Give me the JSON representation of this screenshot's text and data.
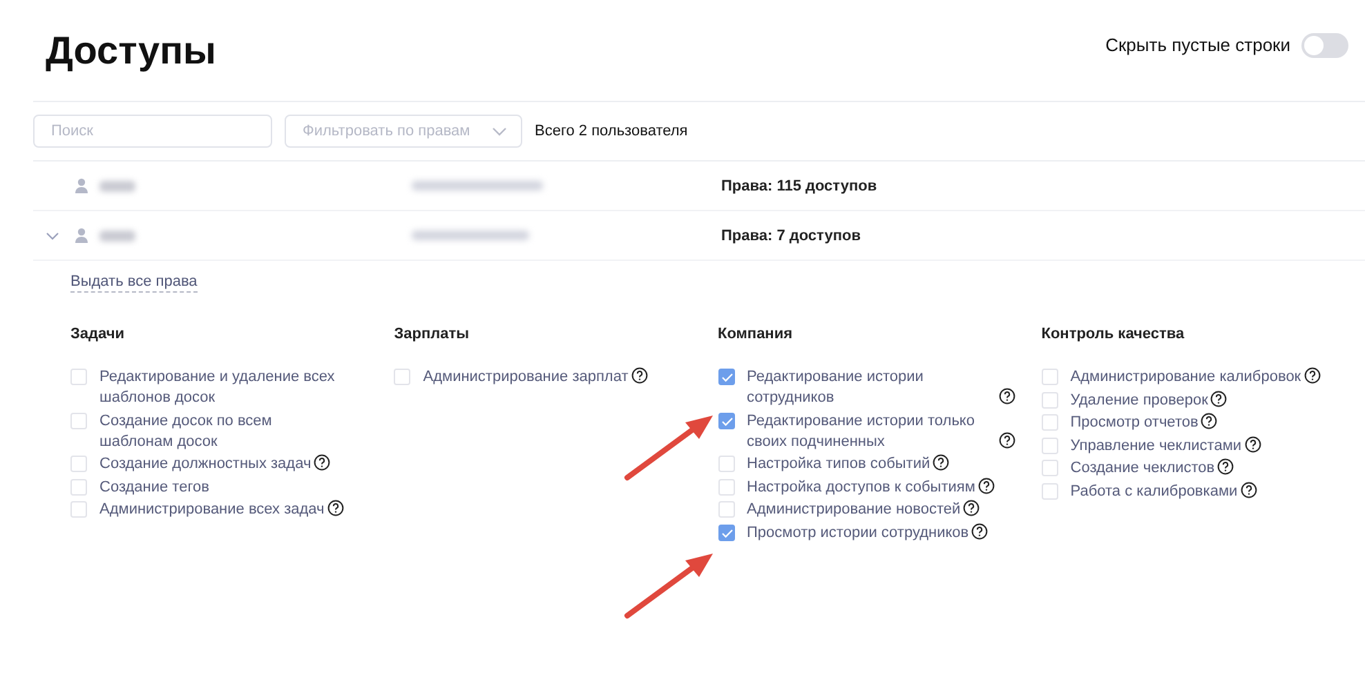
{
  "title": "Доступы",
  "hide_empty": {
    "label": "Скрыть пустые строки",
    "on": false
  },
  "search": {
    "placeholder": "Поиск"
  },
  "filter": {
    "placeholder": "Фильтровать по правам"
  },
  "total": "Всего 2 пользователя",
  "users": [
    {
      "expanded": false,
      "rights": "Права: 115 доступов"
    },
    {
      "expanded": true,
      "rights": "Права: 7 доступов"
    }
  ],
  "grant_all": "Выдать все права",
  "groups": [
    {
      "title": "Задачи",
      "items": [
        {
          "label": "Редактирование и удаление всех шаблонов досок",
          "checked": false,
          "help": false
        },
        {
          "label": "Создание досок по всем шаблонам досок",
          "checked": false,
          "help": false
        },
        {
          "label": "Создание должностных задач",
          "checked": false,
          "help": true
        },
        {
          "label": "Создание тегов",
          "checked": false,
          "help": false
        },
        {
          "label": "Администрирование всех задач",
          "checked": false,
          "help": true
        }
      ]
    },
    {
      "title": "Зарплаты",
      "items": [
        {
          "label": "Администрирование зарплат",
          "checked": false,
          "help": true
        }
      ]
    },
    {
      "title": "Компания",
      "items": [
        {
          "label": "Редактирование истории сотрудников",
          "checked": true,
          "help": true
        },
        {
          "label": "Редактирование истории только своих подчиненных",
          "checked": true,
          "help": true
        },
        {
          "label": "Настройка типов событий",
          "checked": false,
          "help": true
        },
        {
          "label": "Настройка доступов к событиям",
          "checked": false,
          "help": true
        },
        {
          "label": "Администрирование новостей",
          "checked": false,
          "help": true
        },
        {
          "label": "Просмотр истории сотрудников",
          "checked": true,
          "help": true
        }
      ]
    },
    {
      "title": "Контроль качества",
      "items": [
        {
          "label": "Администрирование калибровок",
          "checked": false,
          "help": true
        },
        {
          "label": "Удаление проверок",
          "checked": false,
          "help": true
        },
        {
          "label": "Просмотр отчетов",
          "checked": false,
          "help": true
        },
        {
          "label": "Управление чеклистами",
          "checked": false,
          "help": true
        },
        {
          "label": "Создание чеклистов",
          "checked": false,
          "help": true
        },
        {
          "label": "Работа с калибровками",
          "checked": false,
          "help": true
        }
      ]
    }
  ]
}
